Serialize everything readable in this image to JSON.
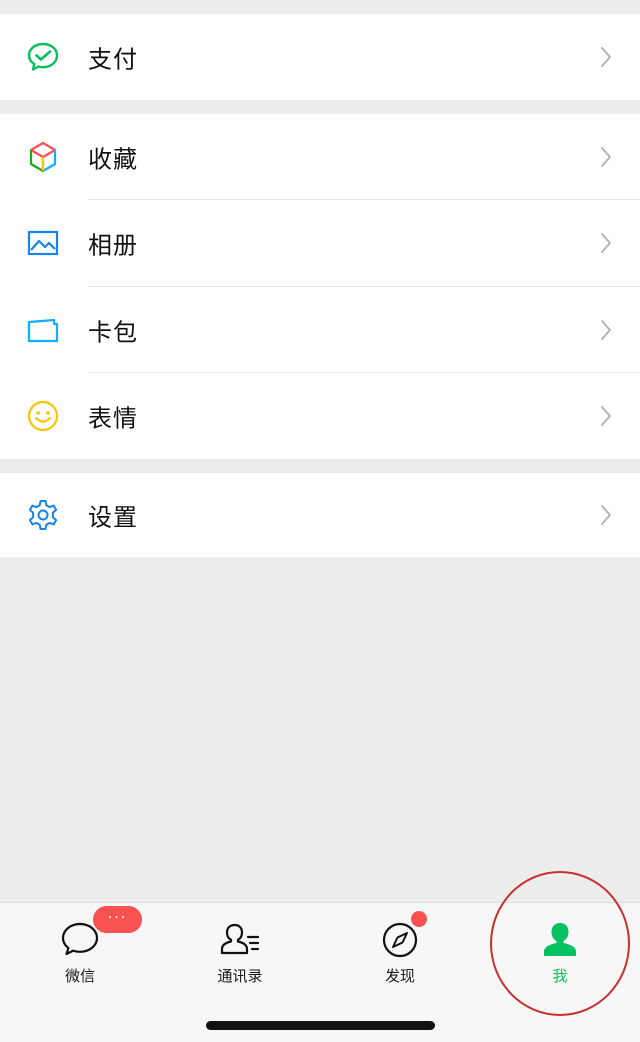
{
  "menu": {
    "pay": {
      "label": "支付",
      "icon": "pay-icon"
    },
    "items": [
      {
        "label": "收藏",
        "icon": "favorites-icon"
      },
      {
        "label": "相册",
        "icon": "album-icon"
      },
      {
        "label": "卡包",
        "icon": "card-wallet-icon"
      },
      {
        "label": "表情",
        "icon": "sticker-icon"
      }
    ],
    "settings": {
      "label": "设置",
      "icon": "gear-icon"
    }
  },
  "tabbar": {
    "tabs": [
      {
        "label": "微信",
        "icon": "chat-bubble-icon",
        "active": false
      },
      {
        "label": "通讯录",
        "icon": "contacts-icon",
        "active": false
      },
      {
        "label": "发现",
        "icon": "compass-icon",
        "active": false
      },
      {
        "label": "我",
        "icon": "person-icon",
        "active": true
      }
    ],
    "chats_badge": "···"
  },
  "colors": {
    "accent": "#07c160",
    "badge": "#fa5151",
    "background": "#ededed",
    "annotation": "#c9302c"
  }
}
